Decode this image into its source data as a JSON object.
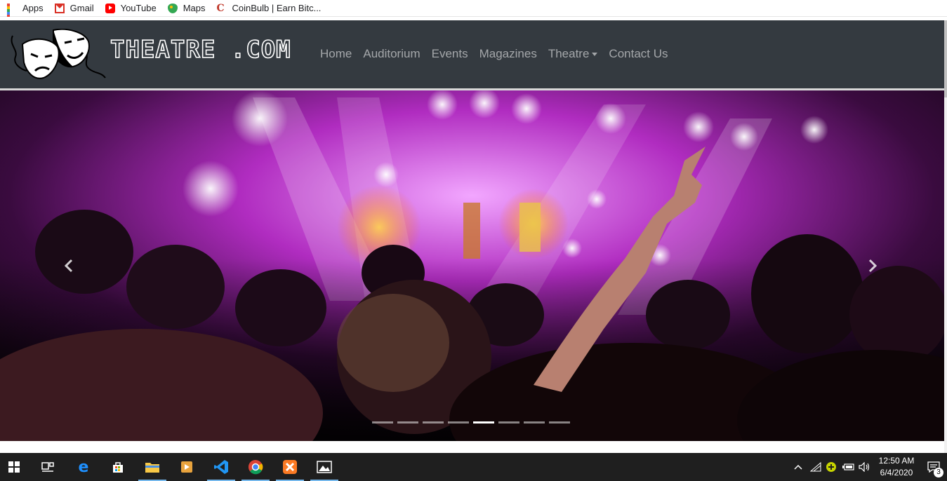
{
  "bookmarks": [
    {
      "label": "Apps",
      "icon": "apps-grid-icon"
    },
    {
      "label": "Gmail",
      "icon": "gmail-icon"
    },
    {
      "label": "YouTube",
      "icon": "youtube-icon"
    },
    {
      "label": "Maps",
      "icon": "maps-icon"
    },
    {
      "label": "CoinBulb | Earn Bitc...",
      "icon": "coinbulb-icon"
    }
  ],
  "navbar": {
    "brand": "THEATRE .COM",
    "logo_icon": "theatre-masks-icon",
    "links": [
      {
        "label": "Home"
      },
      {
        "label": "Auditorium"
      },
      {
        "label": "Events"
      },
      {
        "label": "Magazines"
      },
      {
        "label": "Theatre",
        "dropdown": true
      },
      {
        "label": "Contact Us"
      }
    ],
    "background": "#343a40"
  },
  "carousel": {
    "image": "concert-crowd-photo",
    "slide_count": 8,
    "active_index": 4,
    "prev_icon": "chevron-left-icon",
    "next_icon": "chevron-right-icon"
  },
  "taskbar": {
    "apps": [
      "windows-start-icon",
      "task-view-icon",
      "edge-icon",
      "store-icon",
      "file-explorer-icon",
      "media-player-icon",
      "vscode-icon",
      "chrome-icon",
      "xampp-icon",
      "photos-icon"
    ],
    "tray_icons": [
      "chevron-up-icon",
      "wifi-icon",
      "shield-icon",
      "battery-icon",
      "volume-icon"
    ],
    "time": "12:50 AM",
    "date": "6/4/2020",
    "notifications": "3"
  }
}
